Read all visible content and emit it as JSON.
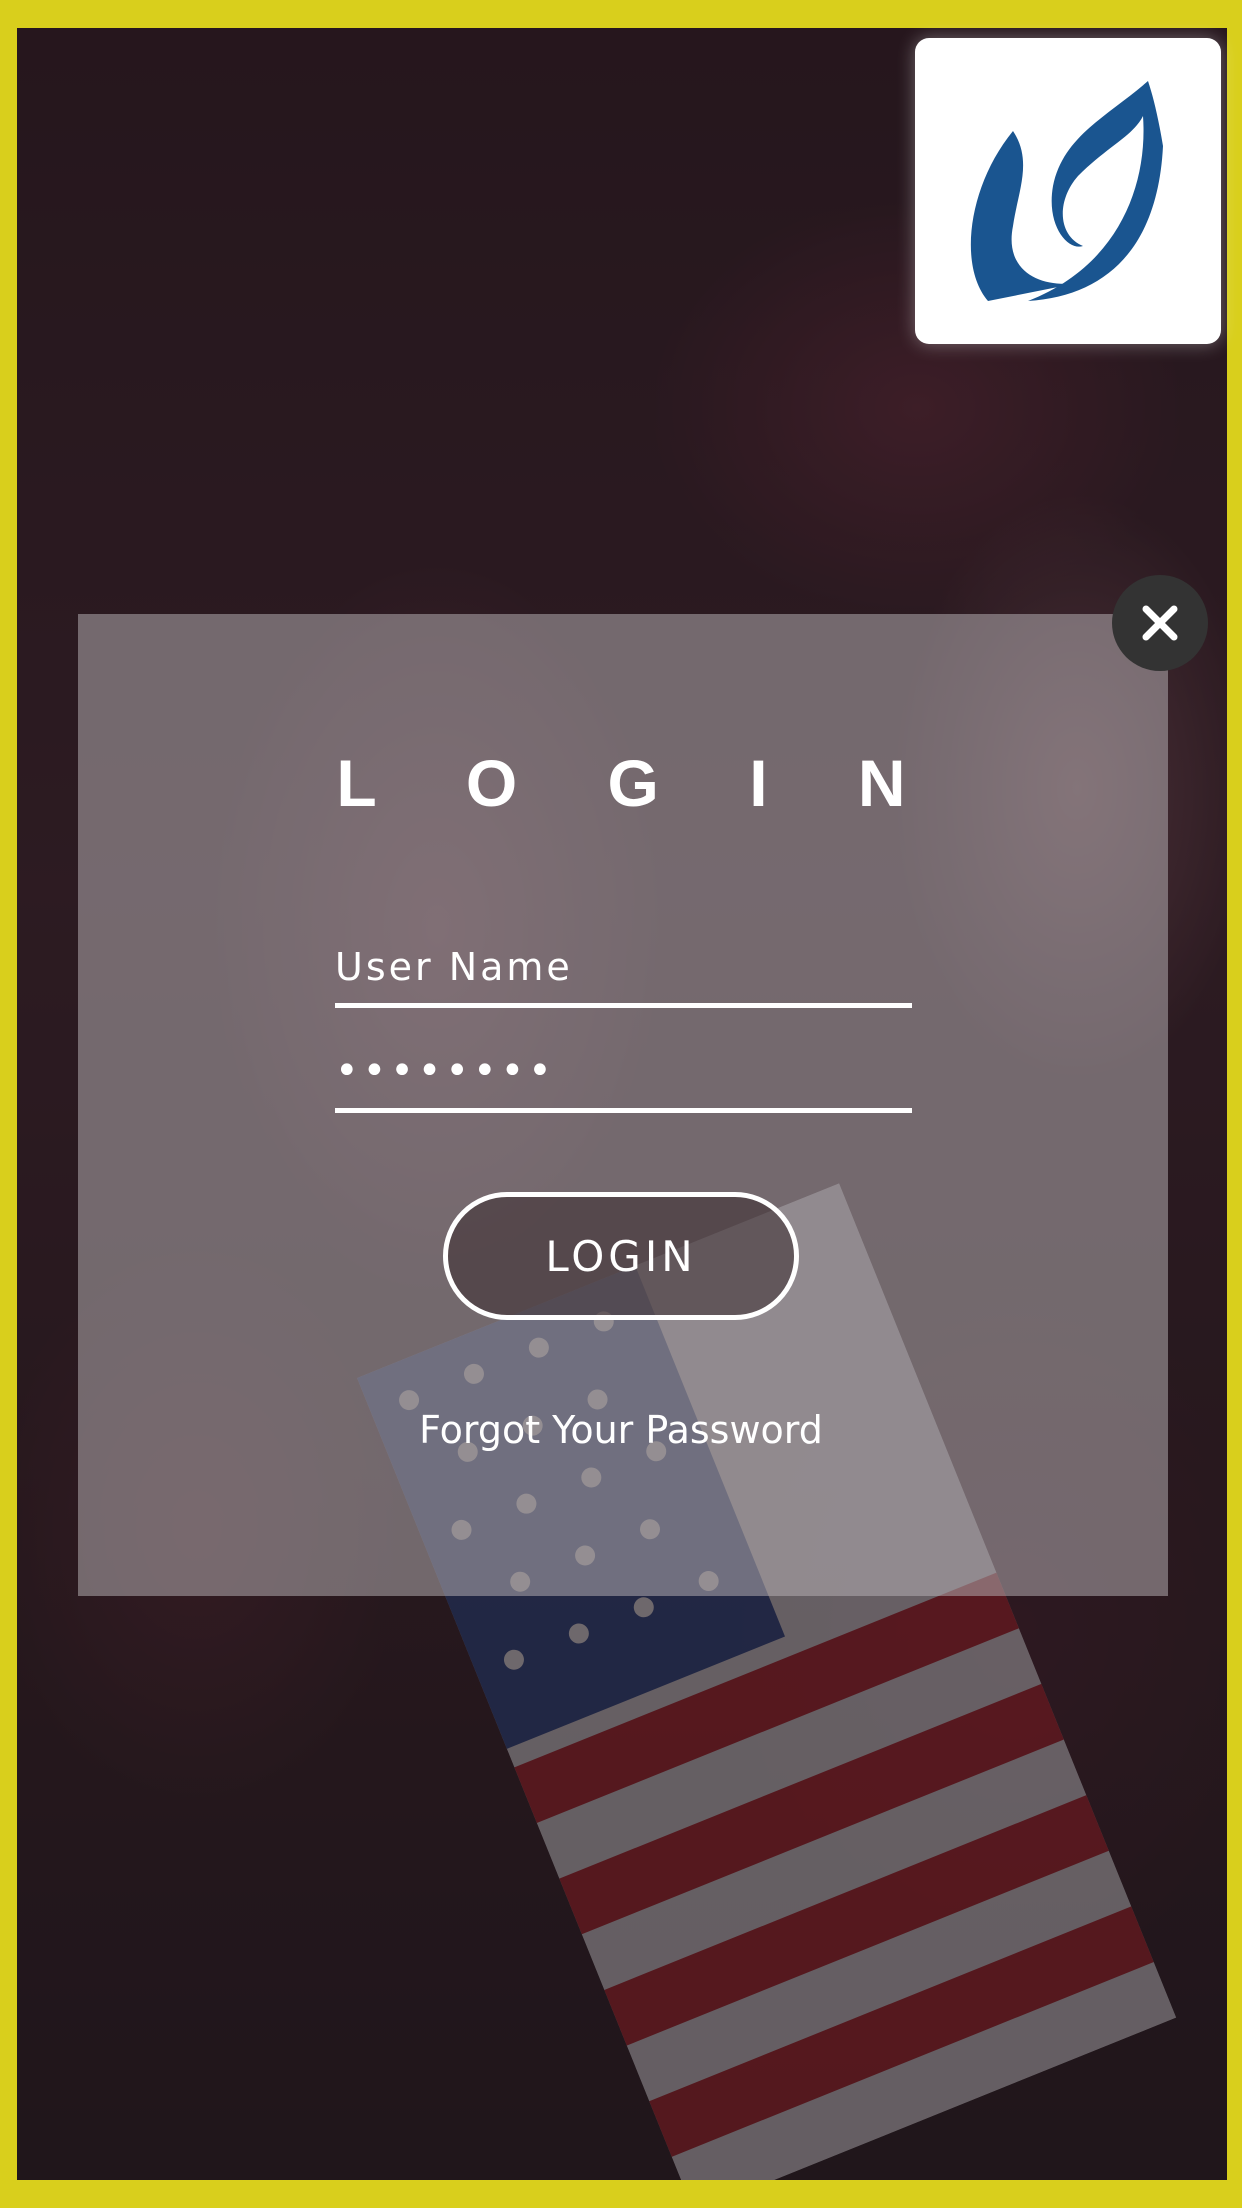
{
  "logo": {
    "icon": "leaf-logo-icon",
    "color": "#1a5590"
  },
  "close": {
    "icon": "close-icon"
  },
  "login_form": {
    "title": "L O G I N",
    "username": {
      "placeholder": "User Name",
      "value": ""
    },
    "password": {
      "value": "••••••••"
    },
    "submit_label": "LOGIN",
    "forgot_label": "Forgot Your Password"
  },
  "colors": {
    "frame_border": "#d9cf1c",
    "text": "#ffffff",
    "close_button": "#333333"
  }
}
